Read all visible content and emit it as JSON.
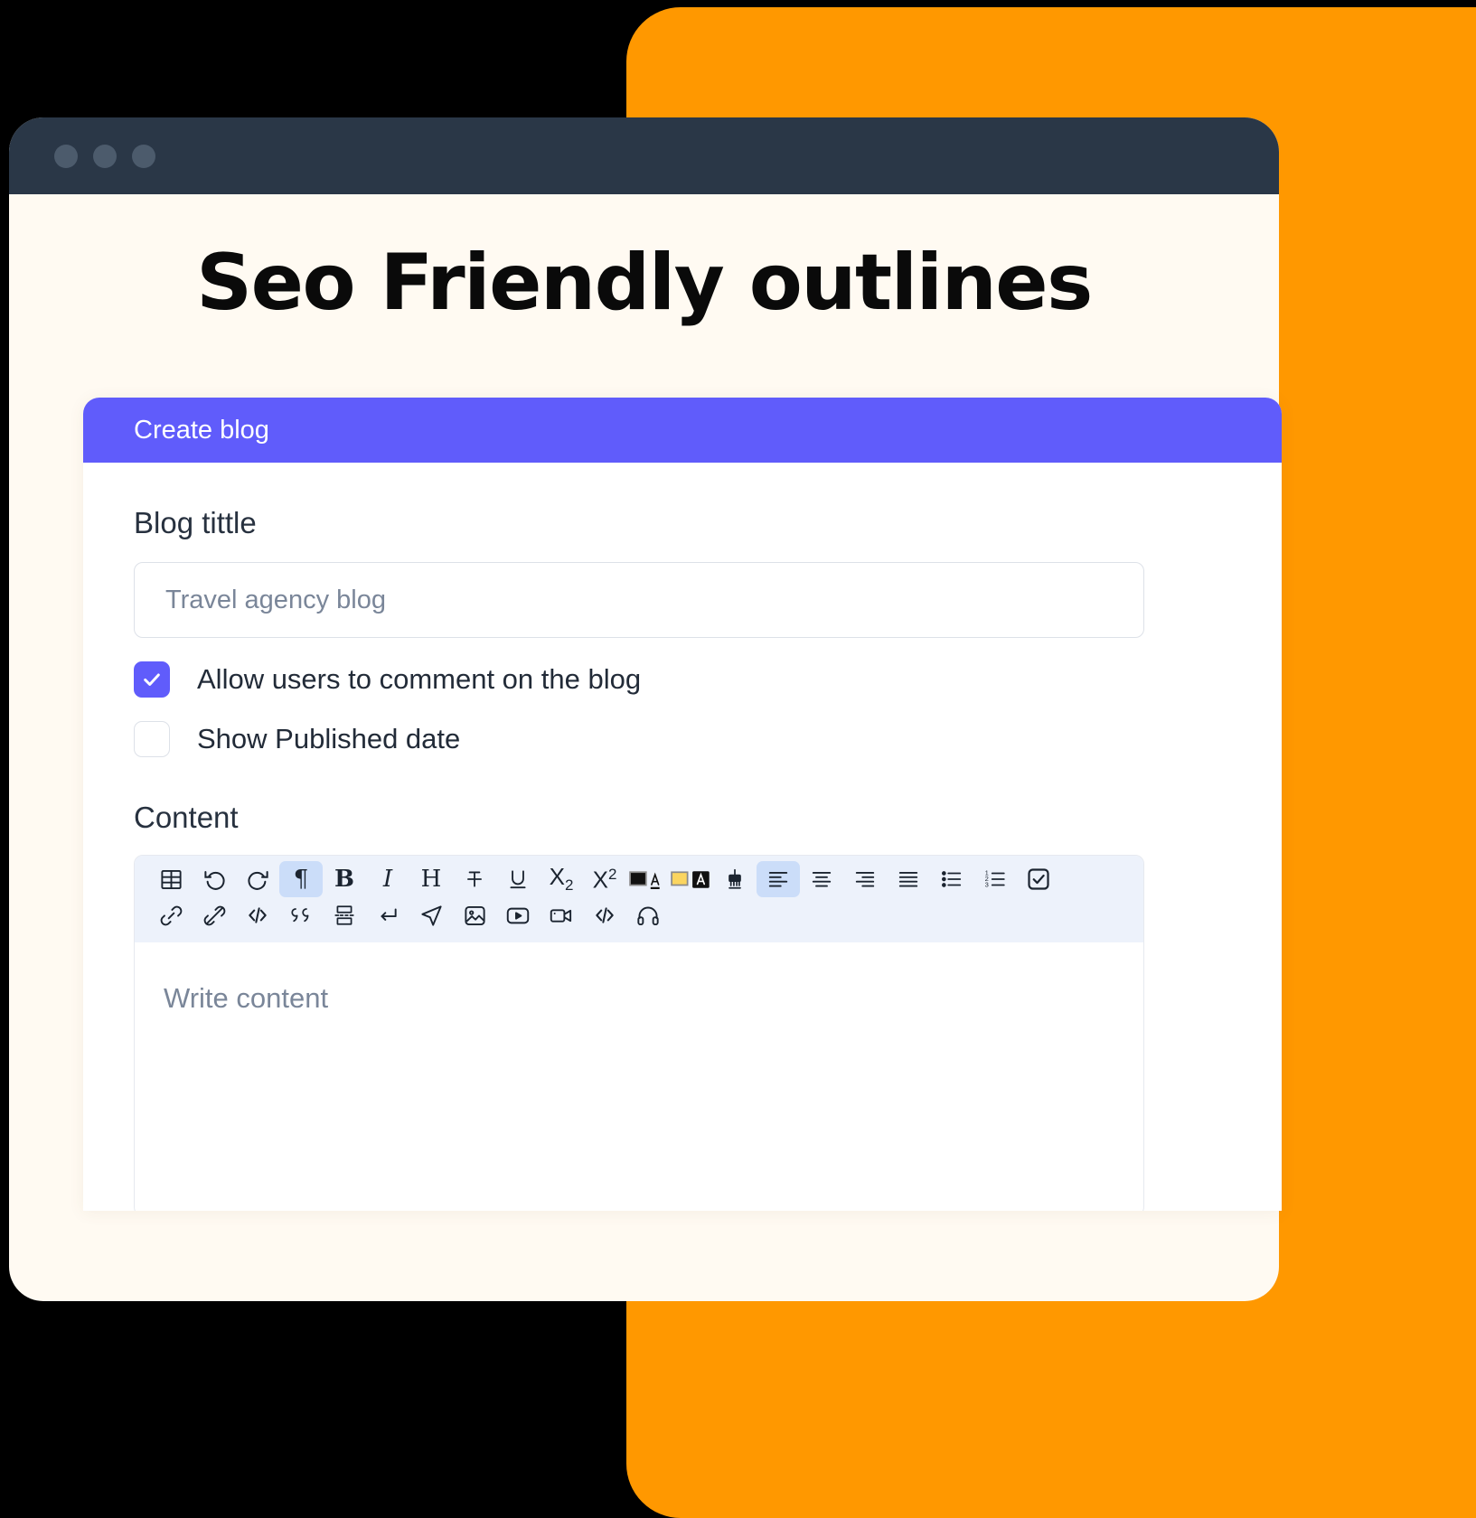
{
  "window": {
    "dots": [
      "dot-red",
      "dot-yellow",
      "dot-green"
    ],
    "dot_color": "#4C5B6C",
    "titlebar_color": "#2A3747",
    "page_background": "#FFFAF2",
    "backdrop_color": "#FF9800"
  },
  "page": {
    "title": "Seo Friendly outlines"
  },
  "card": {
    "header_title": "Create blog",
    "header_color": "#605CFB"
  },
  "form": {
    "blog_title_label": "Blog tittle",
    "blog_title_value": "",
    "blog_title_placeholder": "Travel agency blog",
    "checkboxes": [
      {
        "label": "Allow users to comment on the blog",
        "checked": true
      },
      {
        "label": "Show Published date",
        "checked": false
      }
    ],
    "content_label": "Content",
    "content_value": "",
    "content_placeholder": "Write content"
  },
  "editor_toolbar": {
    "background": "#EDF2FB",
    "active_background": "#CBDDF9",
    "row1": [
      {
        "name": "table-icon",
        "title": "Table",
        "active": false
      },
      {
        "name": "undo-icon",
        "title": "Undo",
        "active": false
      },
      {
        "name": "redo-icon",
        "title": "Redo",
        "active": false
      },
      {
        "name": "paragraph-icon",
        "title": "Paragraph",
        "active": true
      },
      {
        "name": "bold-icon",
        "title": "Bold",
        "active": false
      },
      {
        "name": "italic-icon",
        "title": "Italic",
        "active": false
      },
      {
        "name": "heading-icon",
        "title": "Heading",
        "active": false
      },
      {
        "name": "strikethrough-icon",
        "title": "Strikethrough",
        "active": false
      },
      {
        "name": "underline-icon",
        "title": "Underline",
        "active": false
      },
      {
        "name": "subscript-icon",
        "title": "Subscript",
        "active": false
      },
      {
        "name": "superscript-icon",
        "title": "Superscript",
        "active": false
      },
      {
        "name": "text-color-icon",
        "title": "Text color",
        "active": false
      },
      {
        "name": "highlight-color-icon",
        "title": "Highlight color",
        "active": false
      },
      {
        "name": "clear-format-icon",
        "title": "Clear formatting",
        "active": false
      },
      {
        "name": "align-left-icon",
        "title": "Align left",
        "active": true
      },
      {
        "name": "align-center-icon",
        "title": "Align center",
        "active": false
      },
      {
        "name": "align-right-icon",
        "title": "Align right",
        "active": false
      },
      {
        "name": "align-justify-icon",
        "title": "Justify",
        "active": false
      },
      {
        "name": "bullet-list-icon",
        "title": "Bulleted list",
        "active": false
      },
      {
        "name": "numbered-list-icon",
        "title": "Numbered list",
        "active": false
      },
      {
        "name": "checklist-icon",
        "title": "Checklist",
        "active": false
      }
    ],
    "row2": [
      {
        "name": "link-icon",
        "title": "Insert link",
        "active": false
      },
      {
        "name": "unlink-icon",
        "title": "Remove link",
        "active": false
      },
      {
        "name": "code-icon",
        "title": "Inline code",
        "active": false
      },
      {
        "name": "quote-icon",
        "title": "Blockquote",
        "active": false
      },
      {
        "name": "page-break-icon",
        "title": "Page break",
        "active": false
      },
      {
        "name": "line-break-icon",
        "title": "Line break",
        "active": false
      },
      {
        "name": "send-icon",
        "title": "Insert",
        "active": false
      },
      {
        "name": "image-icon",
        "title": "Insert image",
        "active": false
      },
      {
        "name": "video-player-icon",
        "title": "Embed video",
        "active": false
      },
      {
        "name": "camera-video-icon",
        "title": "Record video",
        "active": false
      },
      {
        "name": "code-block-icon",
        "title": "Code block",
        "active": false
      },
      {
        "name": "headphones-icon",
        "title": "Audio",
        "active": false
      }
    ]
  },
  "colors": {
    "accent_purple": "#605CFB",
    "accent_orange": "#FF9800",
    "dark_navy": "#2A3747",
    "cream": "#FFFAF2",
    "text_muted": "#7A8699",
    "highlight_yellow": "#FBD55F"
  }
}
